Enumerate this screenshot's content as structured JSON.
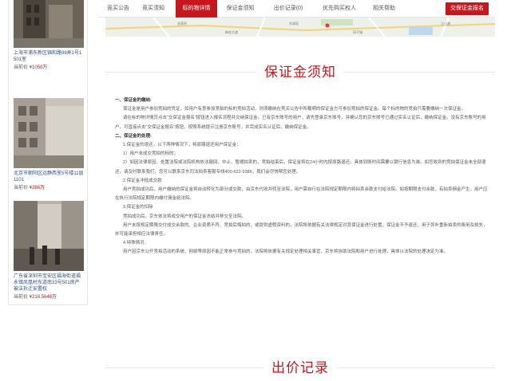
{
  "tabs": [
    {
      "label": "竞买公告"
    },
    {
      "label": "竞买须知"
    },
    {
      "label": "标的物详情"
    },
    {
      "label": "保证金须知"
    },
    {
      "label": "出价记录(0)"
    },
    {
      "label": "优先购买权人"
    },
    {
      "label": "相关帮助"
    }
  ],
  "signup_label": "交保证金报名",
  "sidebar": {
    "cards": [
      {
        "title": "上海市浦东新区锦和路99弄1号1501室",
        "price_prefix": "当前价 ¥",
        "price_value": "1050万"
      },
      {
        "title": "北京市朝阳区远静西里5号楼11层1101",
        "price_prefix": "当前价 ¥",
        "price_value": "286万"
      },
      {
        "title": "广东省深圳市宝安区福海街道福永镇凤凰村东道南33号501房产被法拆迁安置权",
        "price_prefix": "当前价 ¥",
        "price_value": "218.5648万"
      }
    ]
  },
  "map": {
    "labels": [
      "金家桥",
      "梅花大道",
      "东津苑",
      "冈子镇",
      "江山湖"
    ]
  },
  "deposit": {
    "title": "保证金须知",
    "lines": [
      {
        "text": "一、保证金的缴纳:",
        "heading": true
      },
      {
        "text": "保证金是用户参加竞拍的凭证，如用户有意参加竞拍的标的竞拍活动，则须缴纳在竞买公告中所载明的保证金方可参加竞拍的保证金。每个标的物的竞拍只需要缴纳一次保证金。",
        "heading": false
      },
      {
        "text": "请在标的物详情页点击“交保证金报名”按钮进入报名流程并交纳保证金。已有京东账号的用户，请先登录京东账号，并确认您的京东账号已通过实名认证后，缴纳保证金。没有京东账号的用户，可直接点击“交保证金报名”按钮，按照系统提示注册京东账号，并完成实名认证后，缴纳保证金。",
        "heading": false
      },
      {
        "text": "二、保证金的处理:",
        "heading": true
      },
      {
        "text": "1.保证金的退还，以下两种情况下，将原路退还用户保证金：",
        "heading": false
      },
      {
        "text": "1）用户未成交竞拍的标的；",
        "heading": false
      },
      {
        "text": "2）如因法律原因、处置法院或法院机构依法撤回、中止、暂缓拍卖的，竞拍结束后，保证金将在24小时内按原路退还。具体到账时间需要以银行信息为准。如您收到的竞拍保证金未全部退还，请及时联系我们，您可以联系京东司法拍卖客服专线400-622-9386，我们会尽快帮您处理。",
        "heading": false
      },
      {
        "text": "2.保证金冲抵成交款",
        "heading": false
      },
      {
        "text": "用户竞拍成功后，用户缴纳的保证金将自动转化为部分成交款，由京东代收并转至法院，用户需自行在法院规定期限内将拍卖余款支付给法院。如按期限支付余款，有拍卖佣金产生，用户应在执行法院规定期限内缴付佣金给法院。",
        "heading": false
      },
      {
        "text": "3.保证金的扣除",
        "heading": false
      },
      {
        "text": "竞拍成功后，京东依法将成交用户的保证金冻结并移交至法院。",
        "heading": false
      },
      {
        "text": "用户未按规定期限交付成交余款的、企业资质不符、竞拍后悔拍的，或提供虚假资料的，法院将依据有关法律规定对其保证金进行处置，保证金不予退还，用于弥补重新拍卖的费用及损失，并可能承担相应法律责任。",
        "heading": false
      },
      {
        "text": "4.特殊情况",
        "heading": false
      },
      {
        "text": "用户因京东公开竞拍活动的系统、网络等原因不能正常参与竞拍的，法院将依据有关规定处理相关事宜，京东将协助法院和用户进行处理，具体以法院的处理决定为准。",
        "heading": false
      }
    ]
  },
  "bid_record": {
    "title": "出价记录"
  },
  "colors": {
    "brand": "#c8161d",
    "link": "#2b4f8c"
  }
}
